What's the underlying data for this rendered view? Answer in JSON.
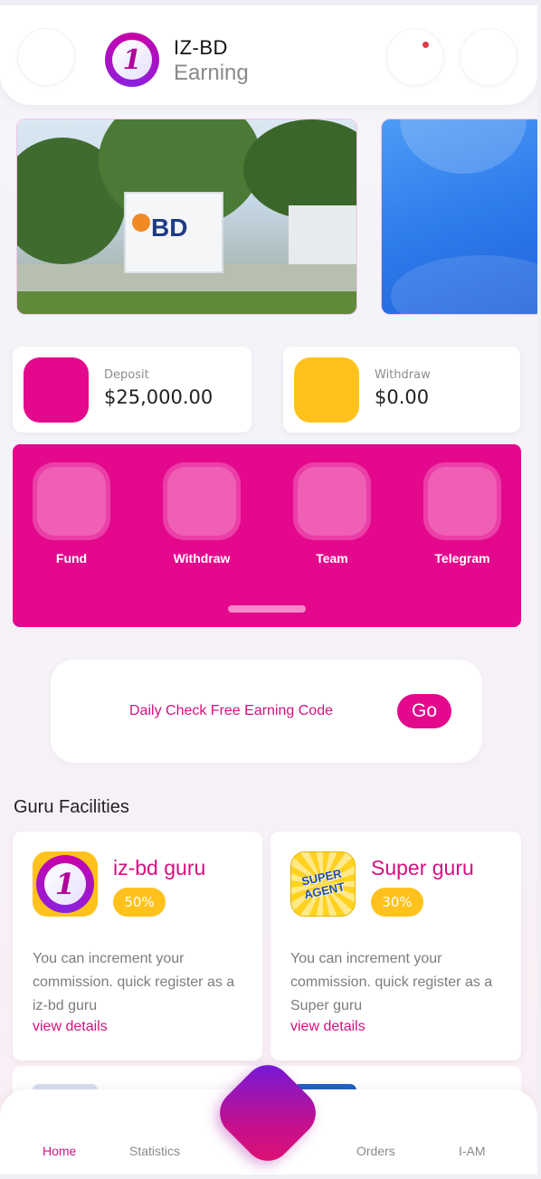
{
  "header": {
    "app_title": "IZ-BD",
    "app_subtitle": "Earning",
    "logo_glyph": "1"
  },
  "banners": {
    "banner1_sign": "BD"
  },
  "balances": {
    "deposit": {
      "label": "Deposit",
      "value": "$25,000.00",
      "color": "#e3088c"
    },
    "withdraw": {
      "label": "Withdraw",
      "value": "$0.00",
      "color": "#ffc21c"
    }
  },
  "actions": [
    {
      "label": "Fund"
    },
    {
      "label": "Withdraw"
    },
    {
      "label": "Team"
    },
    {
      "label": "Telegram"
    }
  ],
  "daily": {
    "text": "Daily Check Free Earning Code",
    "button": "Go"
  },
  "guru_section": {
    "title": "Guru Facilities",
    "cards": [
      {
        "name": "iz-bd guru",
        "badge": "50%",
        "logo_glyph": "1",
        "description": "You can increment your commission. quick register as a iz-bd guru",
        "link": "view details"
      },
      {
        "name": "Super guru",
        "badge": "30%",
        "logo_text": "SUPER AGENT",
        "description": "You can increment your commission. quick register as a Super guru",
        "link": "view details"
      }
    ]
  },
  "bottom_nav": [
    {
      "label": "Home",
      "active": true
    },
    {
      "label": "Statistics",
      "active": false
    },
    {
      "label": "Orders",
      "active": false
    },
    {
      "label": "I-AM",
      "active": false
    }
  ],
  "colors": {
    "accent": "#e3088c",
    "yellow": "#ffc21c"
  }
}
